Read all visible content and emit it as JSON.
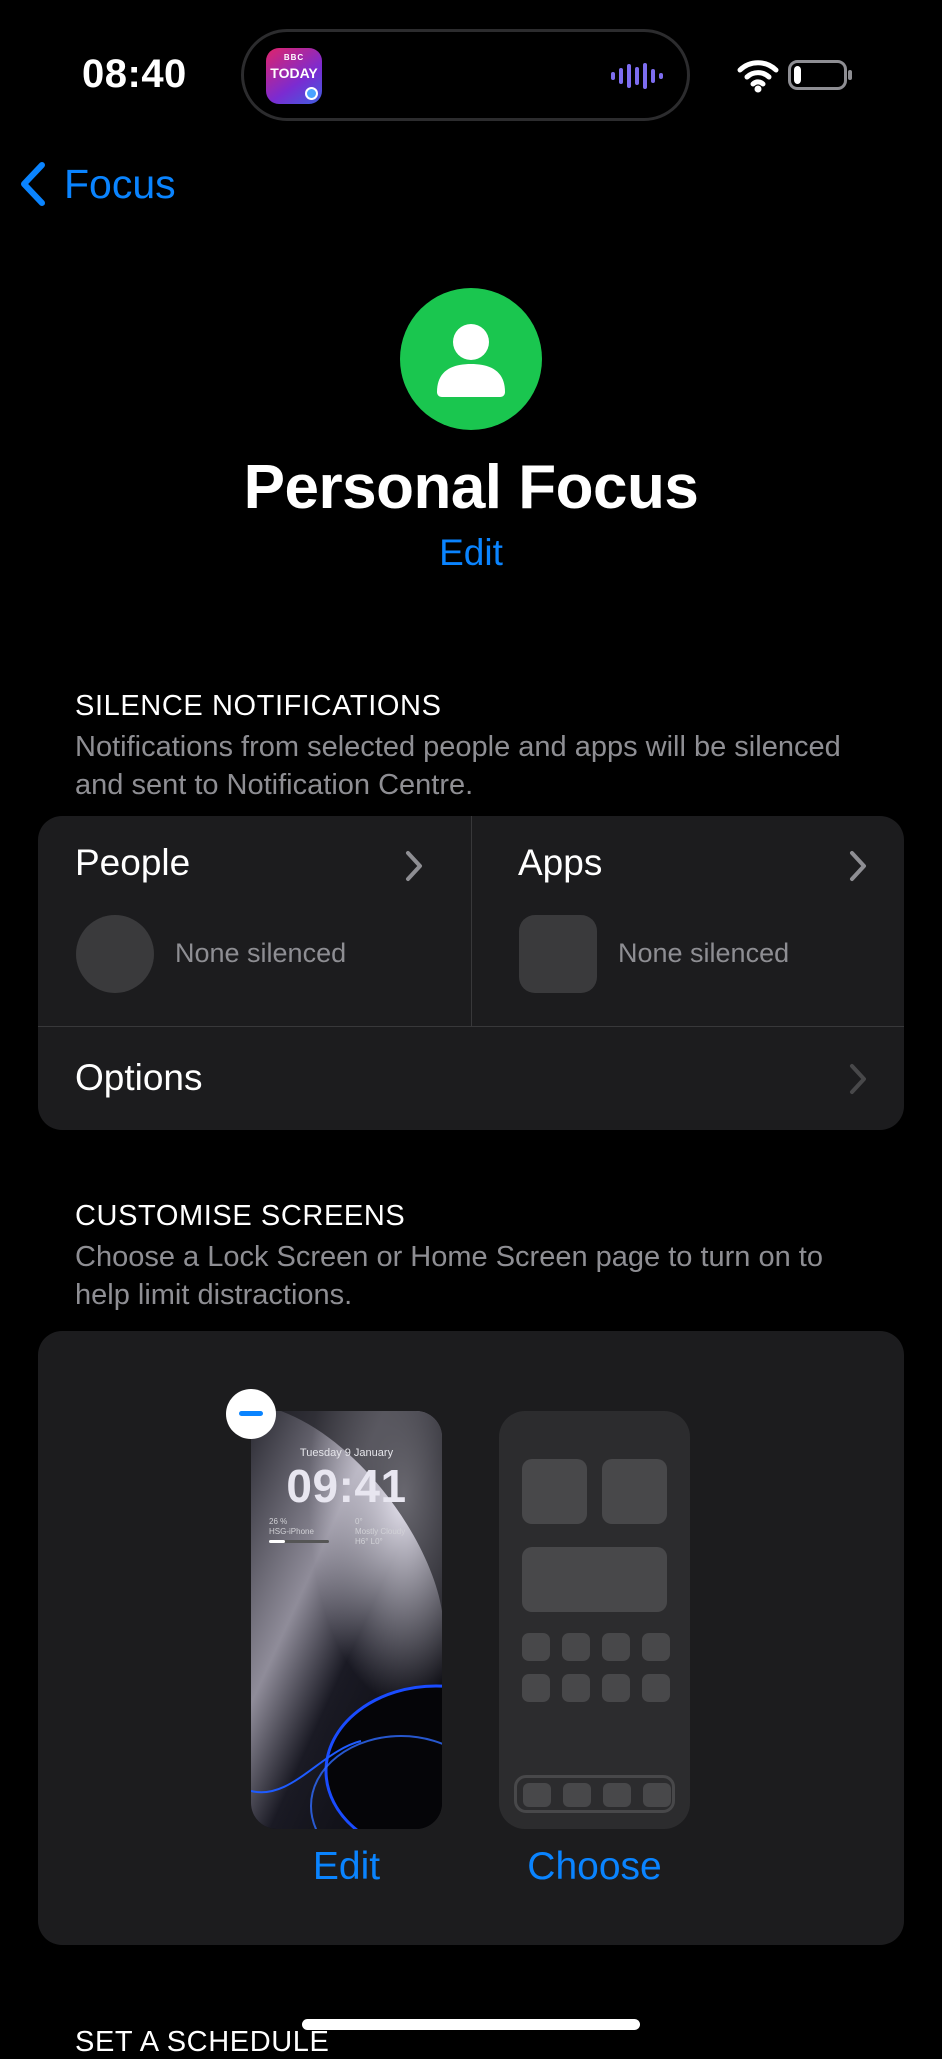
{
  "status_bar": {
    "time": "08:40",
    "live_activity_app": {
      "network": "BBC",
      "label": "TODAY"
    },
    "icons": [
      "audio-waveform-icon",
      "wifi-icon",
      "battery-icon"
    ],
    "battery_level": 0.15
  },
  "nav": {
    "back_label": "Focus",
    "back_icon": "chevron-left-icon"
  },
  "header": {
    "icon": "person-icon",
    "icon_color": "#1ac64f",
    "title": "Personal Focus",
    "edit_label": "Edit"
  },
  "silence_notifications": {
    "header": "SILENCE NOTIFICATIONS",
    "description": "Notifications from selected people and apps will be silenced and sent to Notification Centre.",
    "people": {
      "label": "People",
      "status": "None silenced"
    },
    "apps": {
      "label": "Apps",
      "status": "None silenced"
    },
    "options": {
      "label": "Options"
    }
  },
  "customise_screens": {
    "header": "CUSTOMISE SCREENS",
    "description": "Choose a Lock Screen or Home Screen page to turn on to help limit distractions.",
    "lock_screen": {
      "date": "Tuesday 9 January",
      "time": "09:41",
      "battery_widget": "26 %",
      "device_name": "HSG-iPhone",
      "weather_temp": "0°",
      "weather_condition": "Mostly Cloudy",
      "weather_range": "H6° L0°",
      "action_label": "Edit"
    },
    "home_screen": {
      "action_label": "Choose"
    }
  },
  "next_section": {
    "header": "SET A SCHEDULE"
  },
  "colors": {
    "accent": "#0a84ff",
    "background": "#000000",
    "card": "#1c1c1e",
    "secondary_text": "#8e8e93"
  }
}
